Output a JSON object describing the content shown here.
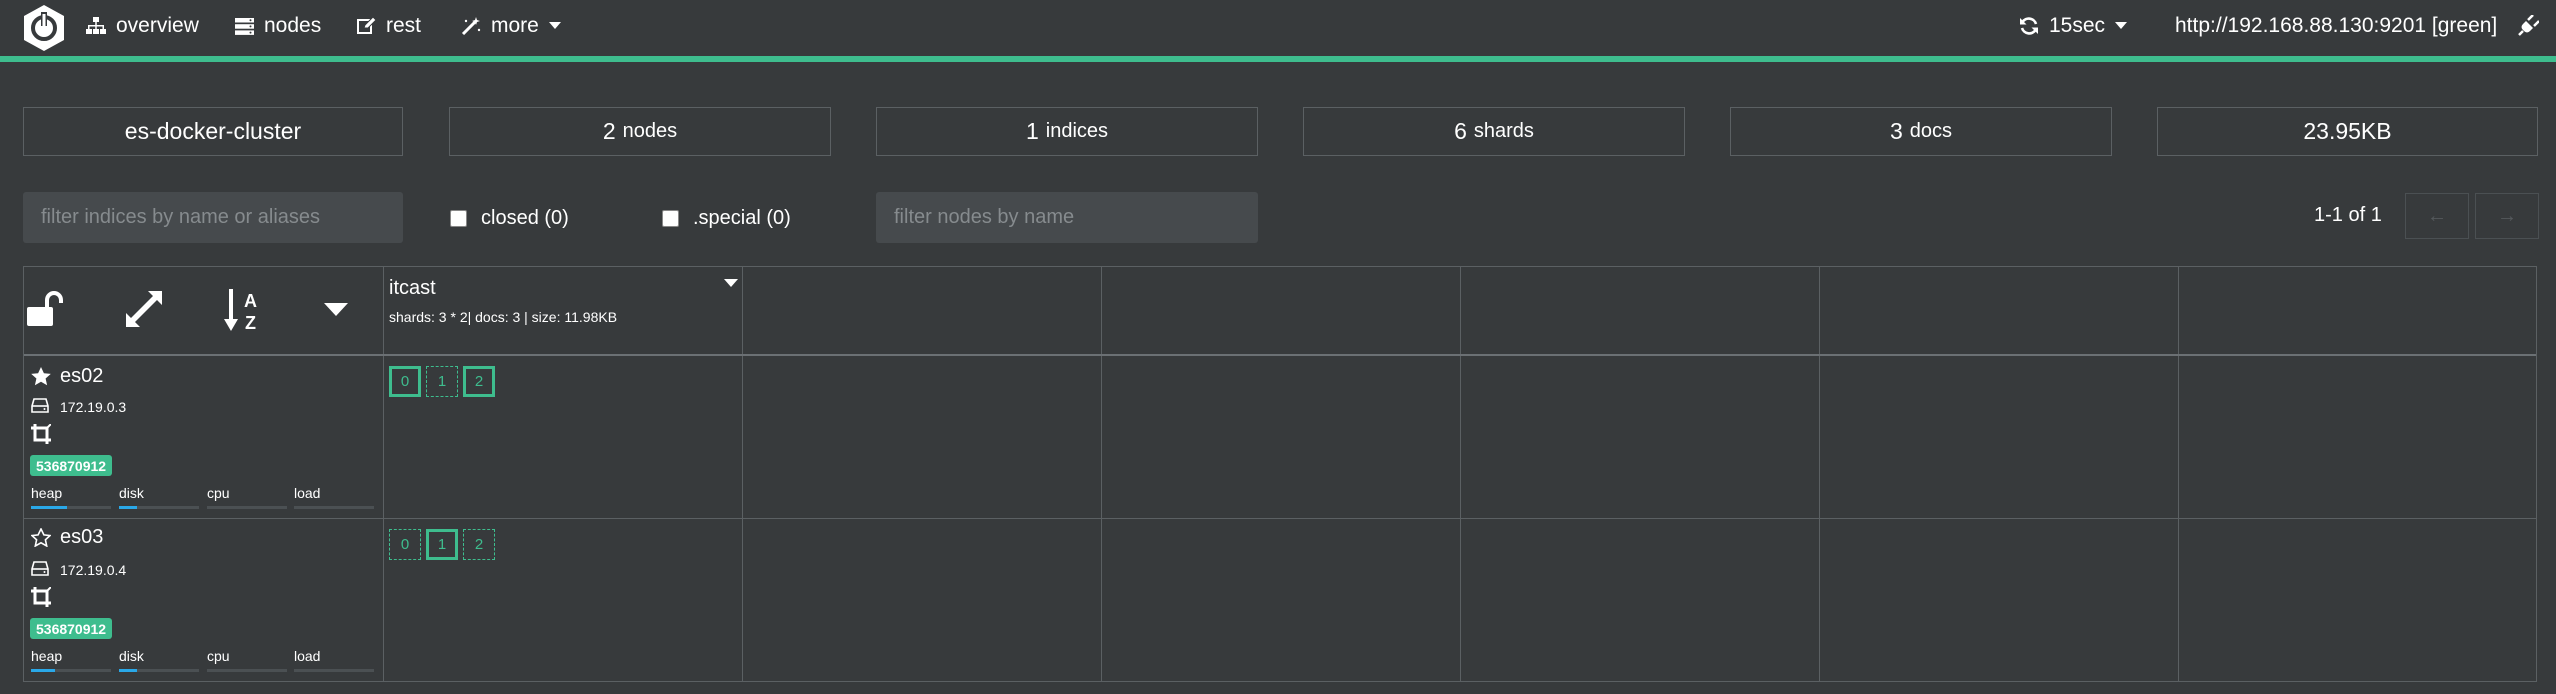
{
  "navbar": {
    "brand_icon": "elasticsearch-head-logo-icon",
    "items": [
      {
        "label": "overview",
        "icon": "sitemap-icon"
      },
      {
        "label": "nodes",
        "icon": "server-icon"
      },
      {
        "label": "rest",
        "icon": "edit-icon"
      },
      {
        "label": "more",
        "icon": "magic-wand-icon"
      }
    ],
    "refresh_label": "15sec",
    "cluster_url": "http://192.168.88.130:9201 [green]",
    "accent_color": "#3ebd8e"
  },
  "stats": {
    "cluster_name": "es-docker-cluster",
    "nodes_num": "2",
    "nodes_label": "nodes",
    "indices_num": "1",
    "indices_label": "indices",
    "shards_num": "6",
    "shards_label": "shards",
    "docs_num": "3",
    "docs_label": "docs",
    "size": "23.95KB"
  },
  "filters": {
    "indices_placeholder": "filter indices by name or aliases",
    "closed_label": "closed (0)",
    "special_label": ".special (0)",
    "nodes_placeholder": "filter nodes by name",
    "pager_text": "1-1 of 1",
    "prev_label": "←",
    "next_label": "→"
  },
  "index": {
    "name": "itcast",
    "meta": "shards: 3 * 2| docs: 3 | size: 11.98KB"
  },
  "nodes": [
    {
      "name": "es02",
      "master": true,
      "ip": "172.19.0.3",
      "badge": "536870912",
      "metrics": [
        {
          "label": "heap",
          "value": 0.45
        },
        {
          "label": "disk",
          "value": 0.22
        },
        {
          "label": "cpu",
          "value": 0
        },
        {
          "label": "load",
          "value": 0
        }
      ],
      "shards": [
        {
          "label": "0",
          "primary": true
        },
        {
          "label": "1",
          "primary": false
        },
        {
          "label": "2",
          "primary": true
        }
      ]
    },
    {
      "name": "es03",
      "master": false,
      "ip": "172.19.0.4",
      "badge": "536870912",
      "metrics": [
        {
          "label": "heap",
          "value": 0.3
        },
        {
          "label": "disk",
          "value": 0.22
        },
        {
          "label": "cpu",
          "value": 0
        },
        {
          "label": "load",
          "value": 0
        }
      ],
      "shards": [
        {
          "label": "0",
          "primary": false
        },
        {
          "label": "1",
          "primary": true
        },
        {
          "label": "2",
          "primary": false
        }
      ]
    }
  ]
}
